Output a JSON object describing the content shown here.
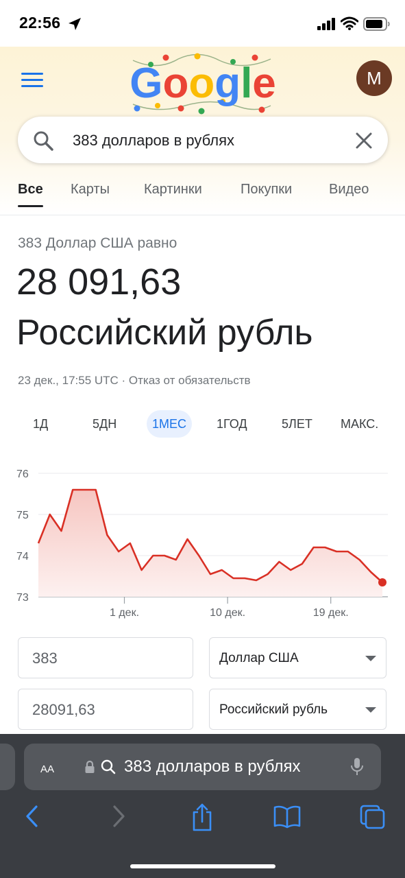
{
  "status_bar": {
    "time": "22:56"
  },
  "header": {
    "avatar_letter": "M",
    "logo_text": "Google"
  },
  "search": {
    "query": "383 долларов в рублях"
  },
  "tabs": [
    {
      "label": "Все",
      "active": true
    },
    {
      "label": "Карты"
    },
    {
      "label": "Картинки"
    },
    {
      "label": "Покупки"
    },
    {
      "label": "Видео"
    }
  ],
  "result": {
    "equation": "383 Доллар США равно",
    "amount": "28 091,63",
    "currency": "Российский рубль",
    "meta": "23 дек., 17:55 UTC · Отказ от обязательств"
  },
  "periods": [
    {
      "label": "1Д"
    },
    {
      "label": "5ДН"
    },
    {
      "label": "1МЕС",
      "active": true
    },
    {
      "label": "1ГОД"
    },
    {
      "label": "5ЛЕТ"
    },
    {
      "label": "МАКС."
    }
  ],
  "chart_data": {
    "type": "area",
    "ylim": [
      73,
      76
    ],
    "yticks": [
      "76",
      "75",
      "74",
      "73"
    ],
    "xticks": [
      {
        "label": "1 дек.",
        "x": 7.5
      },
      {
        "label": "10 дек.",
        "x": 16.5
      },
      {
        "label": "19 дек.",
        "x": 25.5
      }
    ],
    "x": [
      0,
      1,
      2,
      3,
      4,
      5,
      6,
      7,
      8,
      9,
      10,
      11,
      12,
      13,
      14,
      15,
      16,
      17,
      18,
      19,
      20,
      21,
      22,
      23,
      24,
      25,
      26,
      27,
      28,
      29,
      30
    ],
    "values": [
      74.3,
      75.0,
      74.6,
      75.6,
      75.6,
      75.6,
      74.5,
      74.1,
      74.3,
      73.65,
      74.0,
      74.0,
      73.9,
      74.4,
      74.0,
      73.55,
      73.65,
      73.45,
      73.45,
      73.4,
      73.55,
      73.85,
      73.65,
      73.8,
      74.2,
      74.2,
      74.1,
      74.1,
      73.9,
      73.6,
      73.35
    ],
    "line_color": "#d93025",
    "fill_color": "#fce8e6",
    "grid": true
  },
  "converter": {
    "from_amount": "383",
    "from_currency": "Доллар США",
    "to_amount": "28091,63",
    "to_currency": "Российский рубль"
  },
  "safari": {
    "aa_label": "AA",
    "url_text": "383 долларов в рублях"
  }
}
